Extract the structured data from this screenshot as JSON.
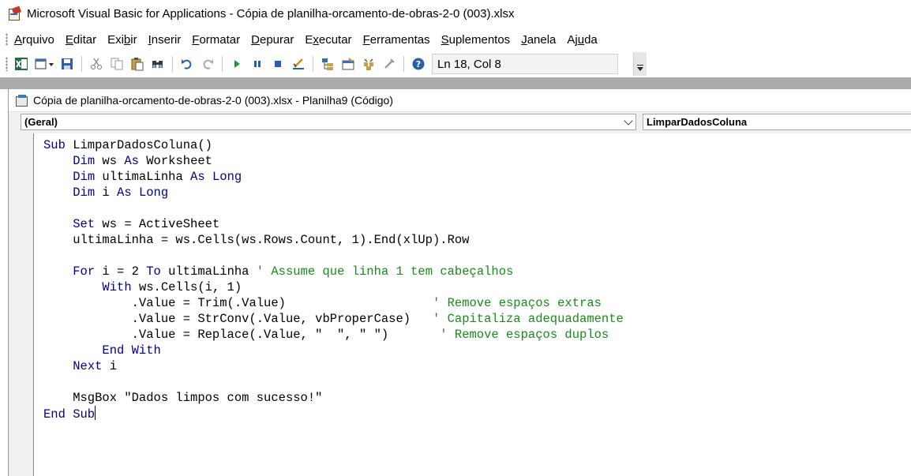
{
  "window": {
    "title": "Microsoft Visual Basic for Applications - Cópia de planilha-orcamento-de-obras-2-0 (003).xlsx"
  },
  "menu": {
    "items": [
      {
        "u": "A",
        "rest": "rquivo"
      },
      {
        "pre": "",
        "u": "E",
        "rest": "ditar"
      },
      {
        "pre": "Exi",
        "u": "b",
        "rest": "ir"
      },
      {
        "pre": "",
        "u": "I",
        "rest": "nserir"
      },
      {
        "pre": "",
        "u": "F",
        "rest": "ormatar"
      },
      {
        "pre": "",
        "u": "D",
        "rest": "epurar"
      },
      {
        "pre": "E",
        "u": "x",
        "rest": "ecutar"
      },
      {
        "pre": "",
        "u": "F",
        "rest": "erramentas"
      },
      {
        "pre": "",
        "u": "S",
        "rest": "uplementos"
      },
      {
        "pre": "",
        "u": "J",
        "rest": "anela"
      },
      {
        "pre": "Aj",
        "u": "u",
        "rest": "da"
      }
    ]
  },
  "toolbar": {
    "icons": [
      "excel-view-icon",
      "insert-module-icon",
      "save-icon",
      "cut-icon",
      "copy-icon",
      "paste-icon",
      "find-icon",
      "undo-icon",
      "redo-icon",
      "run-icon",
      "break-icon",
      "reset-icon",
      "design-mode-icon",
      "project-explorer-icon",
      "properties-icon",
      "object-browser-icon",
      "toolbox-icon",
      "help-icon"
    ],
    "position_text": "Ln 18, Col 8"
  },
  "code_window": {
    "title": "Cópia de planilha-orcamento-de-obras-2-0 (003).xlsx - Planilha9 (Código)",
    "object_combo": "(Geral)",
    "procedure_combo": "LimparDadosColuna"
  },
  "code": {
    "lines": [
      [
        {
          "t": "kw",
          "v": "Sub"
        },
        {
          "t": "n",
          "v": " LimparDadosColuna()"
        }
      ],
      [
        {
          "t": "n",
          "v": "    "
        },
        {
          "t": "kw",
          "v": "Dim"
        },
        {
          "t": "n",
          "v": " ws "
        },
        {
          "t": "kw",
          "v": "As"
        },
        {
          "t": "n",
          "v": " Worksheet"
        }
      ],
      [
        {
          "t": "n",
          "v": "    "
        },
        {
          "t": "kw",
          "v": "Dim"
        },
        {
          "t": "n",
          "v": " ultimaLinha "
        },
        {
          "t": "kw",
          "v": "As"
        },
        {
          "t": "n",
          "v": " "
        },
        {
          "t": "kw",
          "v": "Long"
        }
      ],
      [
        {
          "t": "n",
          "v": "    "
        },
        {
          "t": "kw",
          "v": "Dim"
        },
        {
          "t": "n",
          "v": " i "
        },
        {
          "t": "kw",
          "v": "As"
        },
        {
          "t": "n",
          "v": " "
        },
        {
          "t": "kw",
          "v": "Long"
        }
      ],
      [],
      [
        {
          "t": "n",
          "v": "    "
        },
        {
          "t": "kw",
          "v": "Set"
        },
        {
          "t": "n",
          "v": " ws = ActiveSheet"
        }
      ],
      [
        {
          "t": "n",
          "v": "    ultimaLinha = ws.Cells(ws.Rows.Count, 1).End(xlUp).Row"
        }
      ],
      [],
      [
        {
          "t": "n",
          "v": "    "
        },
        {
          "t": "kw",
          "v": "For"
        },
        {
          "t": "n",
          "v": " i = 2 "
        },
        {
          "t": "kw",
          "v": "To"
        },
        {
          "t": "n",
          "v": " ultimaLinha "
        },
        {
          "t": "cm",
          "v": "' Assume que linha 1 tem cabeçalhos"
        }
      ],
      [
        {
          "t": "n",
          "v": "        "
        },
        {
          "t": "kw",
          "v": "With"
        },
        {
          "t": "n",
          "v": " ws.Cells(i, 1)"
        }
      ],
      [
        {
          "t": "n",
          "v": "            .Value = Trim(.Value)                    "
        },
        {
          "t": "cm",
          "v": "' Remove espaços extras"
        }
      ],
      [
        {
          "t": "n",
          "v": "            .Value = StrConv(.Value, vbProperCase)   "
        },
        {
          "t": "cm",
          "v": "' Capitaliza adequadamente"
        }
      ],
      [
        {
          "t": "n",
          "v": "            .Value = Replace(.Value, \"  \", \" \")       "
        },
        {
          "t": "cm",
          "v": "' Remove espaços duplos"
        }
      ],
      [
        {
          "t": "n",
          "v": "        "
        },
        {
          "t": "kw",
          "v": "End With"
        }
      ],
      [
        {
          "t": "n",
          "v": "    "
        },
        {
          "t": "kw",
          "v": "Next"
        },
        {
          "t": "n",
          "v": " i"
        }
      ],
      [],
      [
        {
          "t": "n",
          "v": "    MsgBox \"Dados limpos com sucesso!\""
        }
      ],
      [
        {
          "t": "kw",
          "v": "End Sub"
        },
        {
          "t": "caret",
          "v": ""
        }
      ]
    ]
  },
  "colors": {
    "keyword": "#00008b",
    "comment": "#1a8a1a",
    "text": "#000000"
  }
}
